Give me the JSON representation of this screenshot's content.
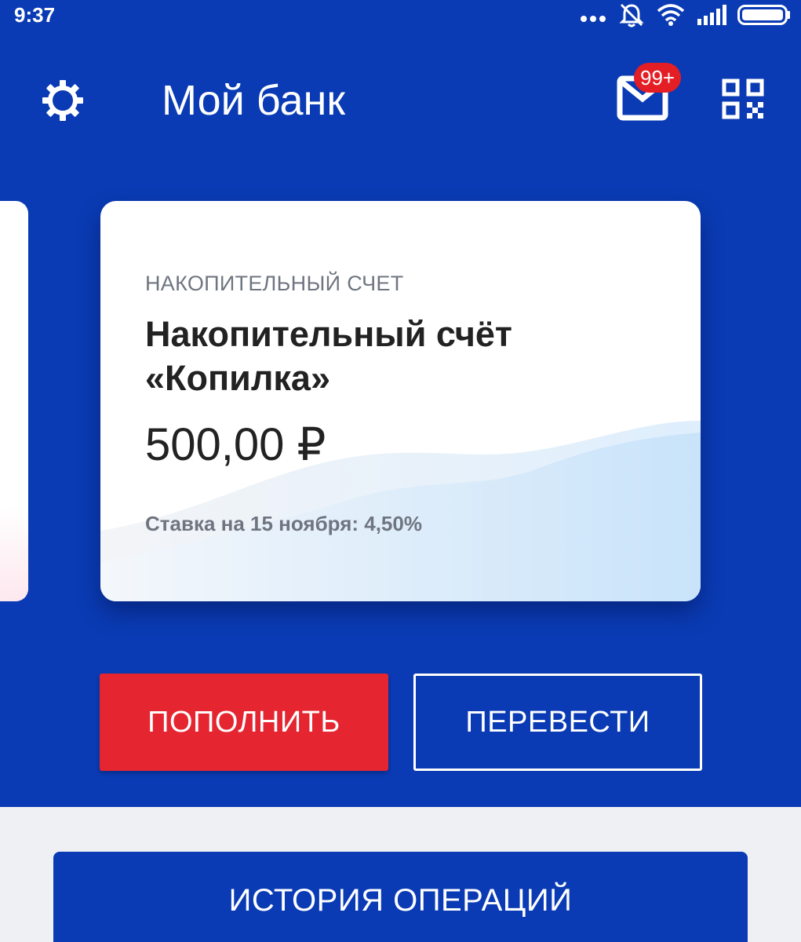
{
  "status_bar": {
    "time": "9:37",
    "icons": [
      "more-dots-icon",
      "bell-muted-icon",
      "wifi-icon",
      "signal-icon",
      "battery-icon"
    ]
  },
  "header": {
    "title": "Мой банк",
    "settings_icon": "gear-icon",
    "mail_icon": "mail-icon",
    "mail_badge": "99+",
    "qr_icon": "qr-code-icon"
  },
  "account_card": {
    "type_label": "НАКОПИТЕЛЬНЫЙ СЧЕТ",
    "name": "Накопительный счёт «Копилка»",
    "amount": "500,00 ₽",
    "rate": "Ставка на 15 ноября: 4,50%"
  },
  "actions": {
    "topup_label": "ПОПОЛНИТЬ",
    "transfer_label": "ПЕРЕВЕСТИ"
  },
  "history": {
    "label": "ИСТОРИЯ ОПЕРАЦИЙ"
  },
  "colors": {
    "brand_blue": "#0a3bb4",
    "accent_red": "#e52530",
    "badge_red": "#e31e24"
  }
}
